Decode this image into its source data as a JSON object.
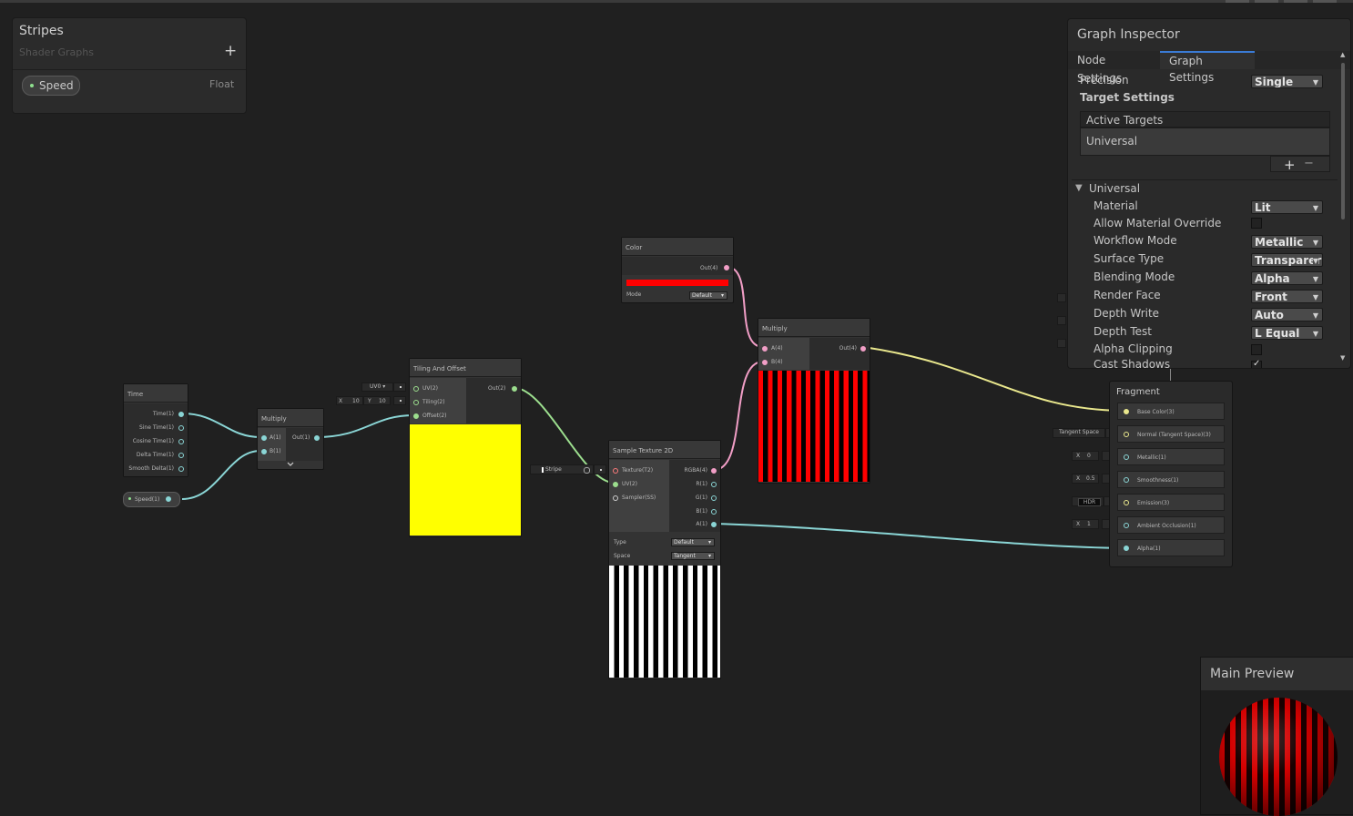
{
  "blackboard": {
    "title": "Stripes",
    "subtitle": "Shader Graphs",
    "add_icon": "+",
    "property": {
      "name": "Speed",
      "type": "Float"
    }
  },
  "nodes": {
    "time": {
      "title": "Time",
      "outputs": [
        "Time(1)",
        "Sine Time(1)",
        "Cosine Time(1)",
        "Delta Time(1)",
        "Smooth Delta(1)"
      ]
    },
    "speed_property": {
      "label": "Speed(1)"
    },
    "multiply_a": {
      "title": "Multiply",
      "inputs": [
        "A(1)",
        "B(1)"
      ],
      "output": "Out(1)",
      "expand_icon": "chevron-down"
    },
    "tiling_offset": {
      "title": "Tiling And Offset",
      "inputs": [
        "UV(2)",
        "Tiling(2)",
        "Offset(2)"
      ],
      "output": "Out(2)",
      "uv_default": "UV0",
      "tiling_x_label": "X",
      "tiling_x": "10",
      "tiling_y_label": "Y",
      "tiling_y": "10",
      "preview_color": "#ffff00"
    },
    "color": {
      "title": "Color",
      "output": "Out(4)",
      "swatch": "#ff0000",
      "mode_label": "Mode",
      "mode_value": "Default"
    },
    "sample_texture": {
      "title": "Sample Texture 2D",
      "inputs": [
        "Texture(T2)",
        "UV(2)",
        "Sampler(SS)"
      ],
      "outputs": [
        "RGBA(4)",
        "R(1)",
        "G(1)",
        "B(1)",
        "A(1)"
      ],
      "texture_default": "Stripe",
      "type_label": "Type",
      "type_value": "Default",
      "space_label": "Space",
      "space_value": "Tangent"
    },
    "multiply_b": {
      "title": "Multiply",
      "inputs": [
        "A(4)",
        "B(4)"
      ],
      "output": "Out(4)"
    }
  },
  "fragment": {
    "title": "Fragment",
    "slots": [
      "Base Color(3)",
      "Normal (Tangent Space)(3)",
      "Metallic(1)",
      "Smoothness(1)",
      "Emission(3)",
      "Ambient Occlusion(1)",
      "Alpha(1)"
    ],
    "defaults": {
      "normal": "Tangent Space",
      "metallic_label": "X",
      "metallic": "0",
      "smoothness_label": "X",
      "smoothness": "0.5",
      "emission": "HDR",
      "ao_label": "X",
      "ao": "1"
    }
  },
  "inspector": {
    "title": "Graph Inspector",
    "tabs": [
      "Node Settings",
      "Graph Settings"
    ],
    "active_tab": "Graph Settings",
    "precision_label": "Precision",
    "precision_value": "Single",
    "target_settings": "Target Settings",
    "active_targets_header": "Active Targets",
    "active_target": "Universal",
    "list_add": "+",
    "list_remove": "−",
    "section": "Universal",
    "settings": [
      {
        "label": "Material",
        "value": "Lit"
      },
      {
        "label": "Allow Material Override",
        "checkbox": false
      },
      {
        "label": "Workflow Mode",
        "value": "Metallic"
      },
      {
        "label": "Surface Type",
        "value": "Transparer"
      },
      {
        "label": "Blending Mode",
        "value": "Alpha"
      },
      {
        "label": "Render Face",
        "value": "Front"
      },
      {
        "label": "Depth Write",
        "value": "Auto"
      },
      {
        "label": "Depth Test",
        "value": "L Equal"
      },
      {
        "label": "Alpha Clipping",
        "checkbox": false
      },
      {
        "label": "Cast Shadows",
        "checkbox": true
      }
    ]
  },
  "main_preview": {
    "title": "Main Preview"
  },
  "colors": {
    "background": "#202020",
    "vector1_wire": "#8ad5d5",
    "vector2_wire": "#9cde8e",
    "vector4_wire": "#f19ec6",
    "vector3_wire": "#e9e78d",
    "accent": "#3a7bd5"
  }
}
